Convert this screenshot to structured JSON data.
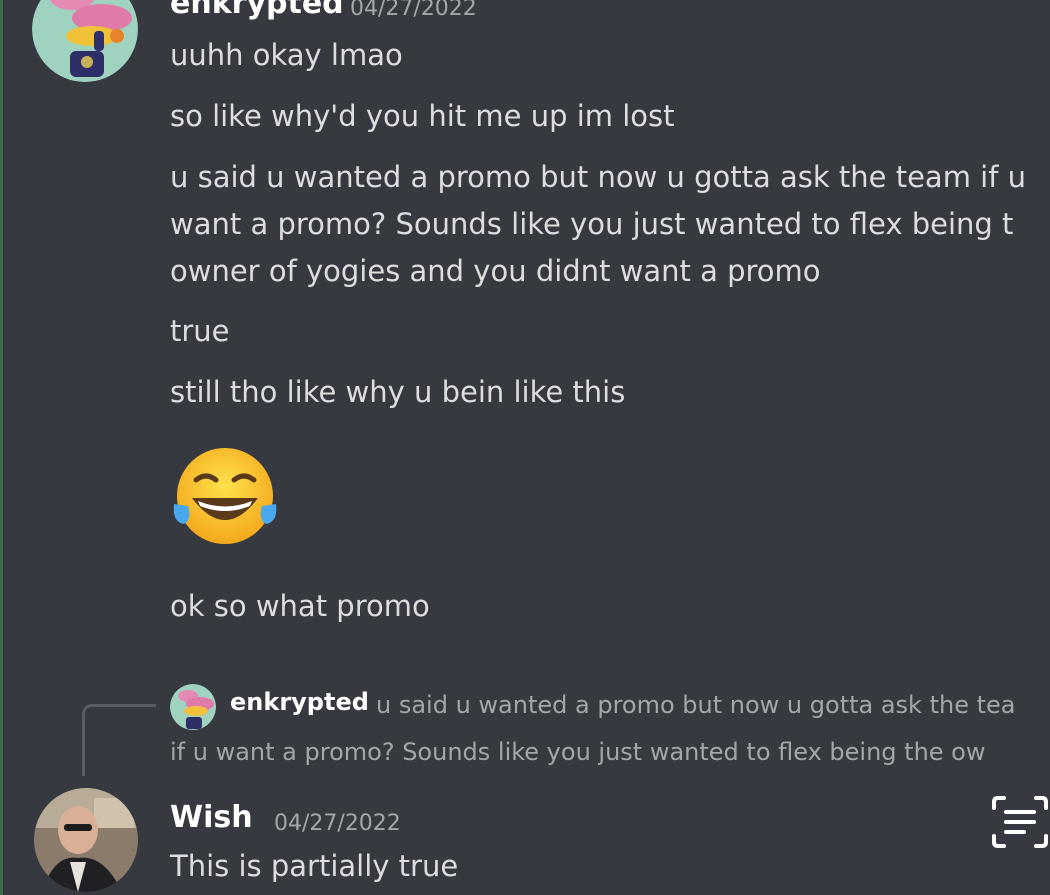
{
  "messages": {
    "first": {
      "author": "enkrypted",
      "timestamp": "04/27/2022",
      "lines": [
        "uuhh okay lmao",
        "so like why'd you hit me up im lost",
        "u said u wanted a promo but now u gotta ask the team if u",
        "want a promo? Sounds like you just wanted to flex being t",
        "owner of yogies and you didnt want a promo",
        "true",
        "still tho like why u bein like this"
      ],
      "emoji": "😂",
      "last_line": "ok so what promo"
    },
    "second": {
      "reply": {
        "author": "enkrypted",
        "line1": "u said u wanted a promo but now u gotta ask the tea",
        "line2": "if u want a promo? Sounds like you just wanted to flex being the ow"
      },
      "author": "Wish",
      "timestamp": "04/27/2022",
      "text": "This is partially true"
    }
  },
  "icons": {
    "jump": "scan-text-icon"
  },
  "colors": {
    "background": "#36393f",
    "text": "#dcddde",
    "muted": "#a3a6aa",
    "author": "#ffffff"
  }
}
